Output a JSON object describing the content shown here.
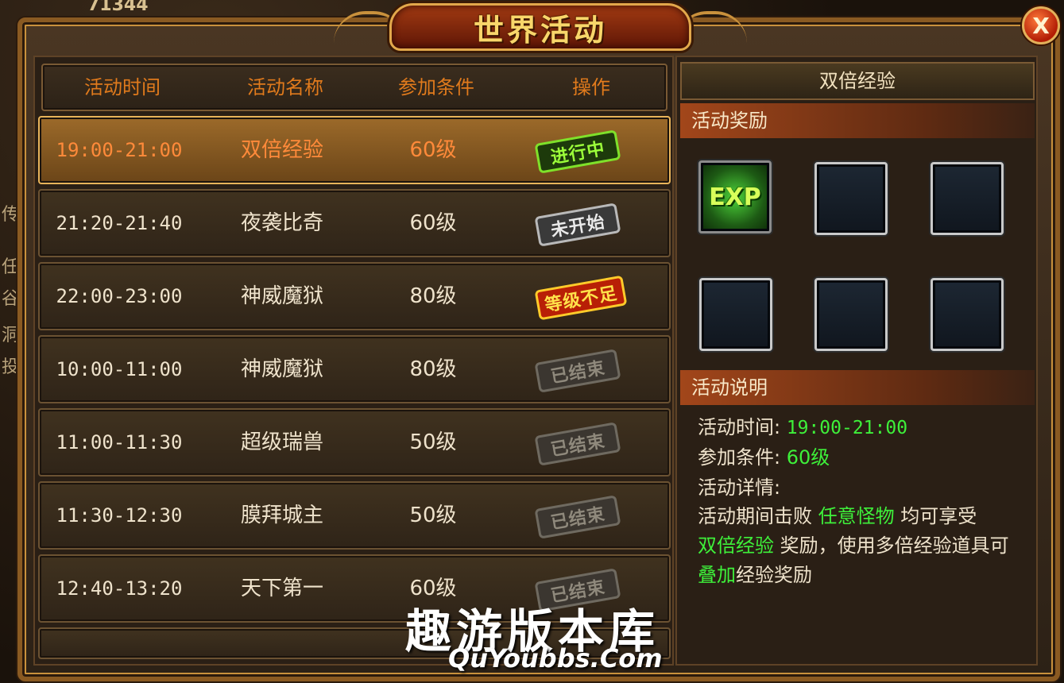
{
  "window": {
    "title": "世界活动",
    "close_label": "X"
  },
  "background": {
    "top_number": "71344",
    "side_texts": [
      "传",
      "任",
      "谷",
      "洞",
      "投"
    ]
  },
  "table": {
    "headers": [
      "活动时间",
      "活动名称",
      "参加条件",
      "操作"
    ],
    "rows": [
      {
        "time": "19:00-21:00",
        "name": "双倍经验",
        "req": "60级",
        "status": "进行中",
        "status_type": "green"
      },
      {
        "time": "21:20-21:40",
        "name": "夜袭比奇",
        "req": "60级",
        "status": "未开始",
        "status_type": "grey"
      },
      {
        "time": "22:00-23:00",
        "name": "神威魔狱",
        "req": "80级",
        "status": "等级不足",
        "status_type": "red"
      },
      {
        "time": "10:00-11:00",
        "name": "神威魔狱",
        "req": "80级",
        "status": "已结束",
        "status_type": "done"
      },
      {
        "time": "11:00-11:30",
        "name": "超级瑞兽",
        "req": "50级",
        "status": "已结束",
        "status_type": "done"
      },
      {
        "time": "11:30-12:30",
        "name": "膜拜城主",
        "req": "50级",
        "status": "已结束",
        "status_type": "done"
      },
      {
        "time": "12:40-13:20",
        "name": "天下第一",
        "req": "60级",
        "status": "已结束",
        "status_type": "done"
      }
    ]
  },
  "detail": {
    "title": "双倍经验",
    "reward_section": "活动奖励",
    "reward_item": "EXP",
    "desc_section": "活动说明",
    "time_label": "活动时间:",
    "time_value": "19:00-21:00",
    "req_label": "参加条件:",
    "req_value": "60级",
    "detail_label": "活动详情:",
    "desc_parts": [
      "活动期间击败",
      "任意怪物",
      "均可享受",
      "双倍经验",
      "奖励，使用多倍经验道具可",
      "叠加",
      "经验奖励"
    ]
  },
  "watermark": {
    "cn": "趣游版本库",
    "en": "QuYoubbs.Com"
  }
}
